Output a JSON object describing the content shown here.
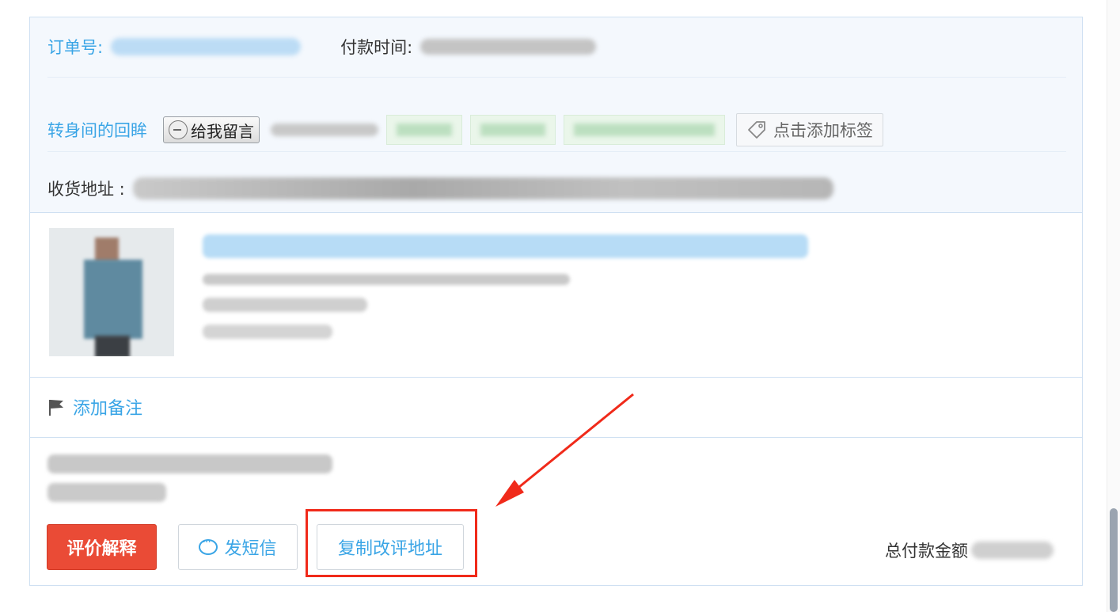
{
  "order": {
    "order_no_label": "订单号:",
    "pay_time_label": "付款时间:"
  },
  "buyer": {
    "name": "转身间的回眸",
    "message_button": "给我留言",
    "add_tag": "点击添加标签"
  },
  "address": {
    "label": "收货地址 :"
  },
  "remark": {
    "add_remark": "添加备注"
  },
  "actions": {
    "explain_review": "评价解释",
    "send_sms": "发短信",
    "copy_review_url": "复制改评地址"
  },
  "total": {
    "label": "总付款金额"
  },
  "colors": {
    "accent_blue": "#3aa5e6",
    "danger_red": "#ea4b36",
    "annotation_red": "#f02a1a",
    "header_bg": "#f4f8fd"
  },
  "icons": [
    "message-bubble-icon",
    "tag-icon",
    "flag-icon",
    "chat-icon",
    "arrow-annotation"
  ]
}
